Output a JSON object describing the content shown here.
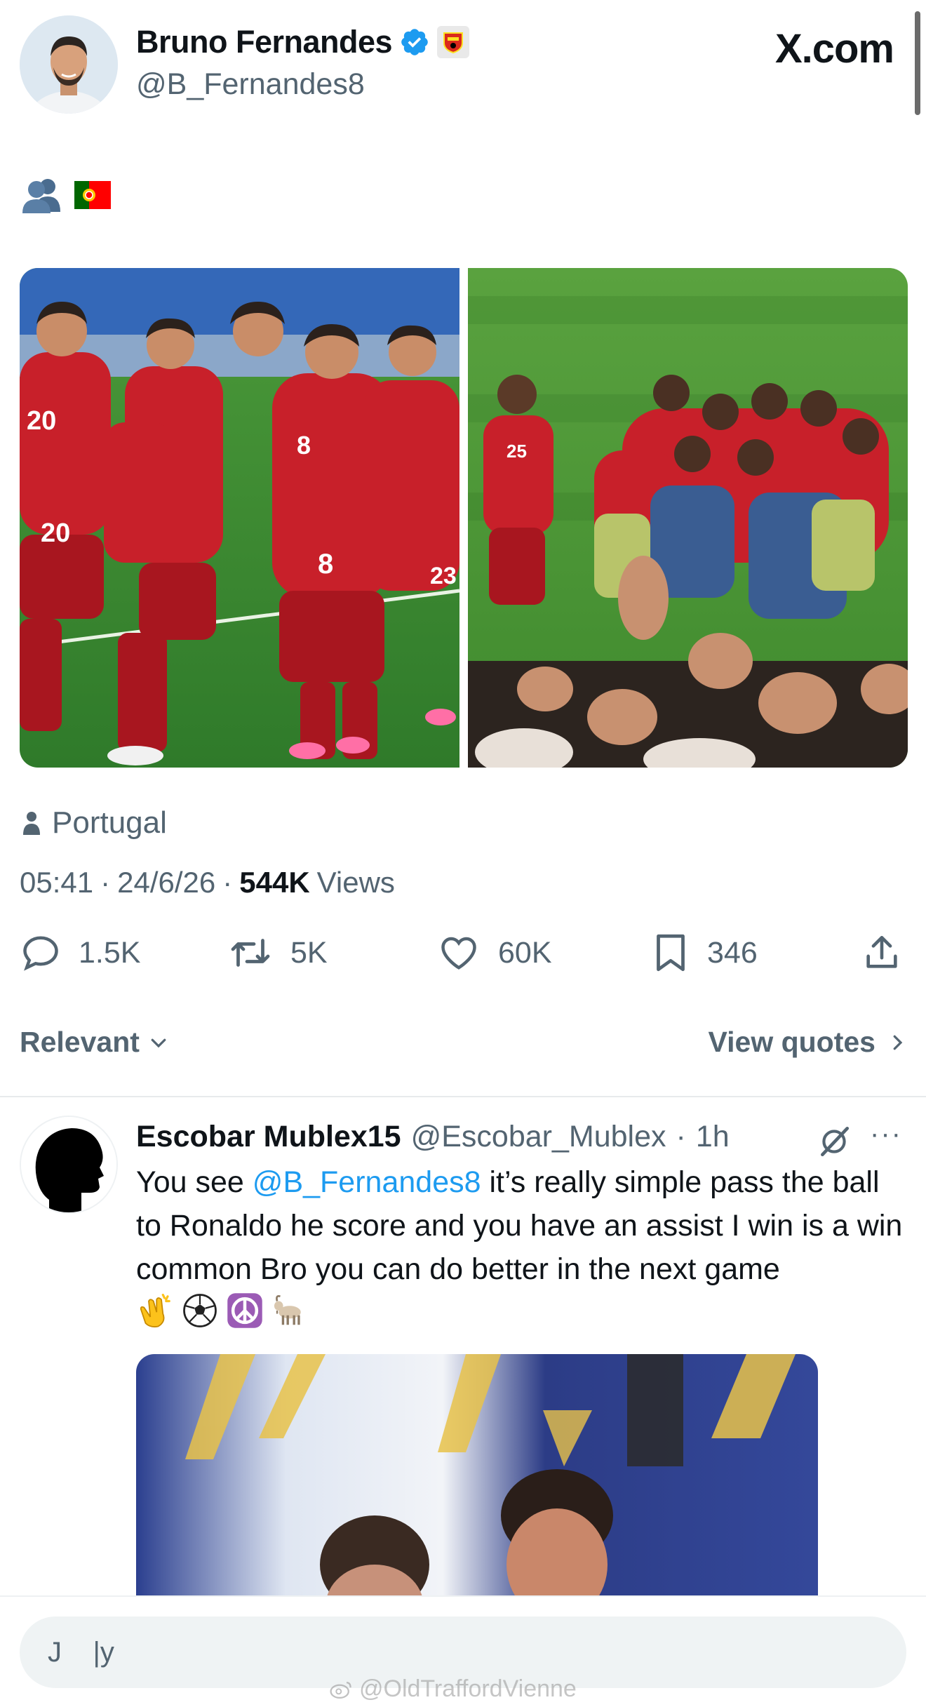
{
  "header": {
    "display_name": "Bruno Fernandes",
    "handle": "@B_Fernandes8",
    "site_logo": "X.com",
    "verified_icon": "verified-badge-icon",
    "affiliation_icon": "manchester-united-crest-icon"
  },
  "tweet": {
    "emojis": [
      "busts-in-silhouette-emoji",
      "portugal-flag-emoji"
    ],
    "media": [
      "team-celebration-photo",
      "team-huddle-photo"
    ],
    "location_icon": "person-icon",
    "location": "Portugal",
    "time": "05:41",
    "date": "24/6/26",
    "separator": "·",
    "views_count": "544K",
    "views_label": "Views",
    "actions": {
      "replies": "1.5K",
      "reposts": "5K",
      "likes": "60K",
      "bookmarks": "346"
    }
  },
  "sort": {
    "label": "Relevant",
    "view_quotes": "View quotes"
  },
  "reply": {
    "name": "Escobar Mublex15",
    "handle": "@Escobar_Mublex",
    "dot": "·",
    "time": "1h",
    "text_before": "You see ",
    "mention": "@B_Fernandes8",
    "text_after": " it’s really simple pass the ball to Ronaldo he score and you have an assist I win is a win common Bro you can do better in the next game ",
    "emojis": [
      "clapping-hands-emoji",
      "soccer-ball-emoji",
      "peace-symbol-emoji",
      "goat-emoji"
    ],
    "more": "···"
  },
  "compose": {
    "value": "J    |y"
  },
  "watermark": "@OldTraffordVienne",
  "colors": {
    "accent_blue": "#1d9bf0",
    "secondary_text": "#536471",
    "jersey_red": "#c8202a",
    "pitch_green": "#3f8a2e"
  }
}
